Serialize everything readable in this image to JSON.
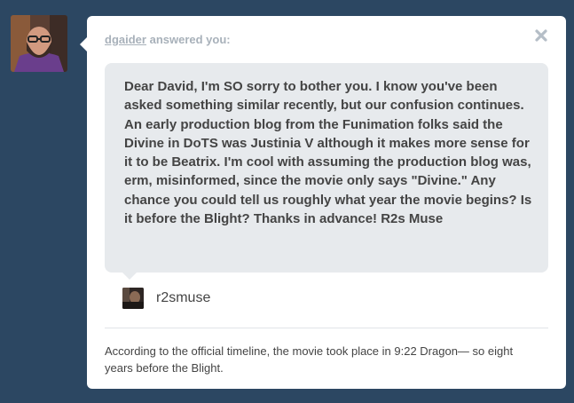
{
  "post": {
    "answerer_avatar_icon": "user-avatar-photo-icon",
    "asker_link": "dgaider",
    "header_suffix": "answered you:",
    "close_icon": "close-icon",
    "question": "Dear David, I'm SO sorry to bother you. I know you've been asked something similar recently, but our confusion continues. An early production blog from the Funimation folks said the Divine in DoTS was Justinia V although it makes more sense for it to be Beatrix. I'm cool with assuming the production blog was, erm, misinformed, since the movie only says \"Divine.\" Any chance you could tell us roughly what year the movie begins? Is it before the Blight? Thanks in advance! R2s Muse",
    "asker_name": "r2smuse",
    "answer": "According to the official timeline, the movie took place in 9:22 Dragon— so eight years before the Blight."
  },
  "colors": {
    "background": "#2c4762",
    "card": "#ffffff",
    "question_bubble": "#e7eaed",
    "header_text": "#a8b1ba",
    "body_text": "#444444"
  }
}
